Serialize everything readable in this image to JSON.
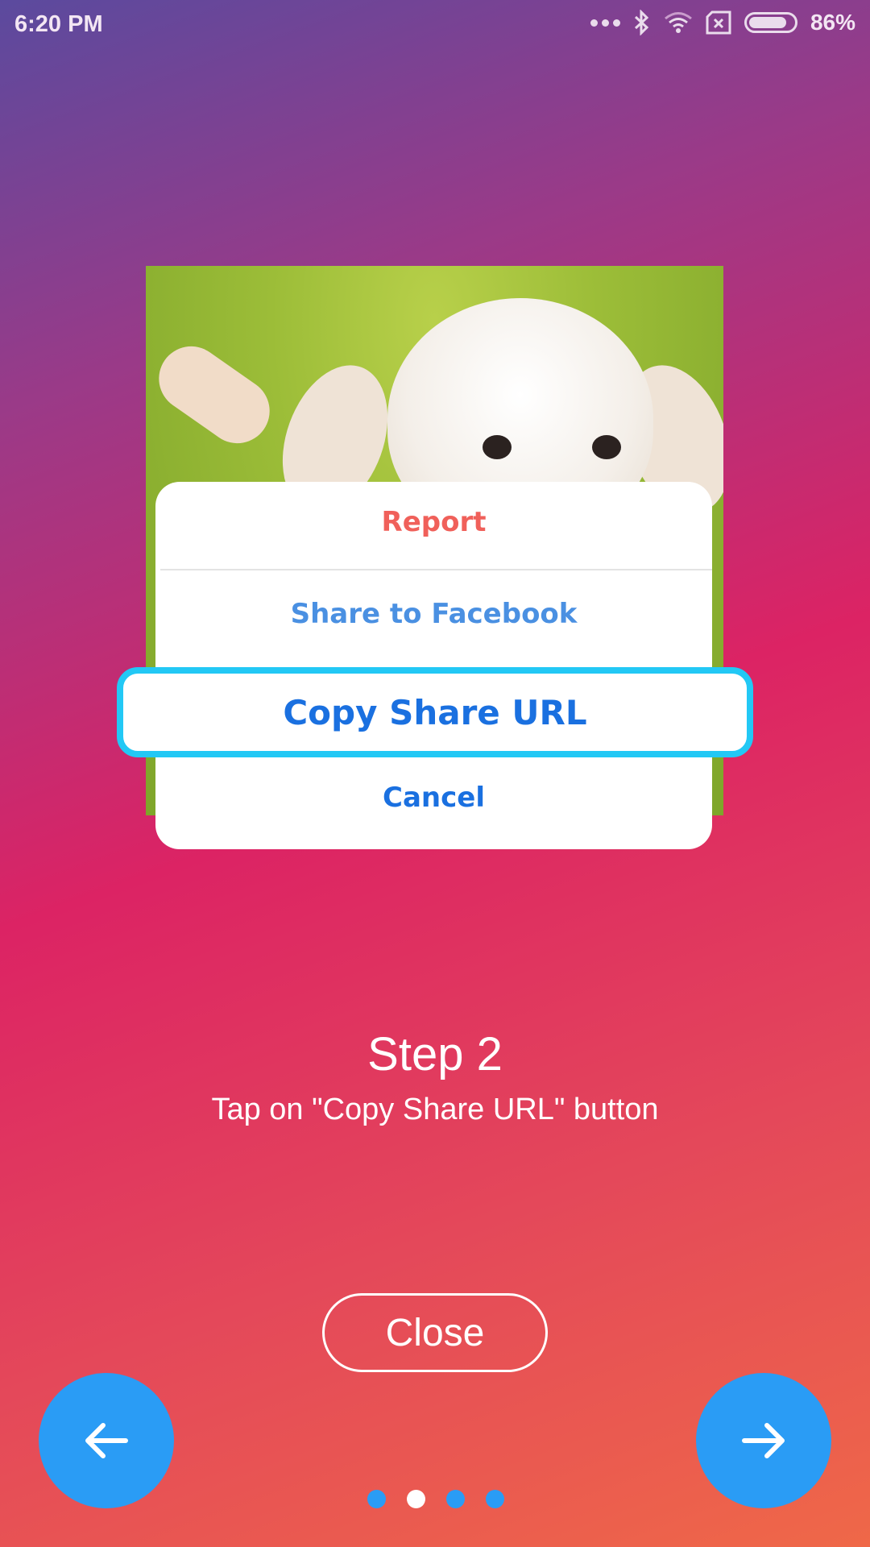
{
  "status_bar": {
    "time": "6:20 PM",
    "battery": "86%",
    "battery_level": 86,
    "icons": [
      "more-dots-icon",
      "bluetooth-icon",
      "wifi-icon",
      "no-sim-icon",
      "battery-icon"
    ]
  },
  "sheet": {
    "report": "Report",
    "share_facebook": "Share to Facebook",
    "copy_url": "Copy Share URL",
    "cancel": "Cancel"
  },
  "step": {
    "title": "Step 2",
    "description": "Tap on \"Copy Share URL\" button"
  },
  "close_label": "Close",
  "pager": {
    "count": 4,
    "active": 1
  },
  "colors": {
    "report": "#f0605a",
    "facebook": "#4a90e2",
    "action": "#1a70e0",
    "highlight": "#22c8f5",
    "nav": "#2a9cf5"
  }
}
